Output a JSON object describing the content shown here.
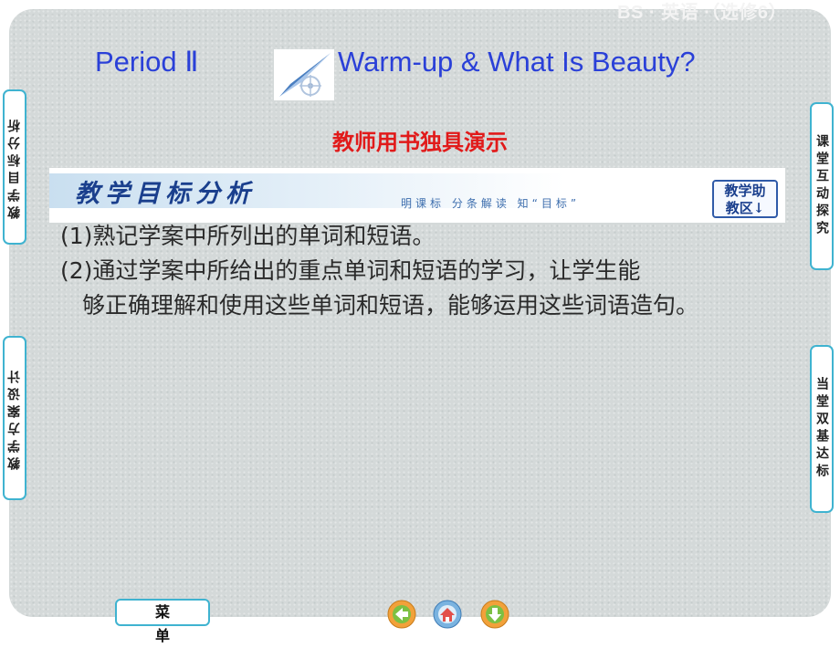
{
  "header": {
    "tag": "BS · 英语 ·（选修6）"
  },
  "title": {
    "left": "Period Ⅱ",
    "right": "Warm-up & What Is Beauty?",
    "logo_icon": "compass-plane-logo"
  },
  "subtitle": "教师用书独具演示",
  "banner": {
    "title": "教学目标分析",
    "subtitle": "明课标  分条解读  知“目标”",
    "assist_button": [
      "教学助",
      "教区↓"
    ]
  },
  "content": {
    "p1": "(1)熟记学案中所列出的单词和短语。",
    "p2_first": "(2)通过学案中所给出的重点单词和短语的学习，让学生能",
    "p2_rest": "够正确理解和使用这些单词和短语，能够运用这些词语造句。"
  },
  "side_tabs": {
    "left_top": "教学目标分析",
    "left_bottom": "教学方案设计",
    "right_top": "课堂互动探究",
    "right_bottom": "当堂双基达标"
  },
  "menu_label": "菜单",
  "nav": {
    "prev_icon": "left-arrow-icon",
    "home_icon": "home-icon",
    "next_icon": "down-arrow-icon"
  },
  "colors": {
    "title_blue": "#2a40d8",
    "subtitle_red": "#e11a1a",
    "tab_border": "#3fb3d0",
    "nav_orange": "#f2a13a",
    "nav_green": "#7cc043"
  }
}
